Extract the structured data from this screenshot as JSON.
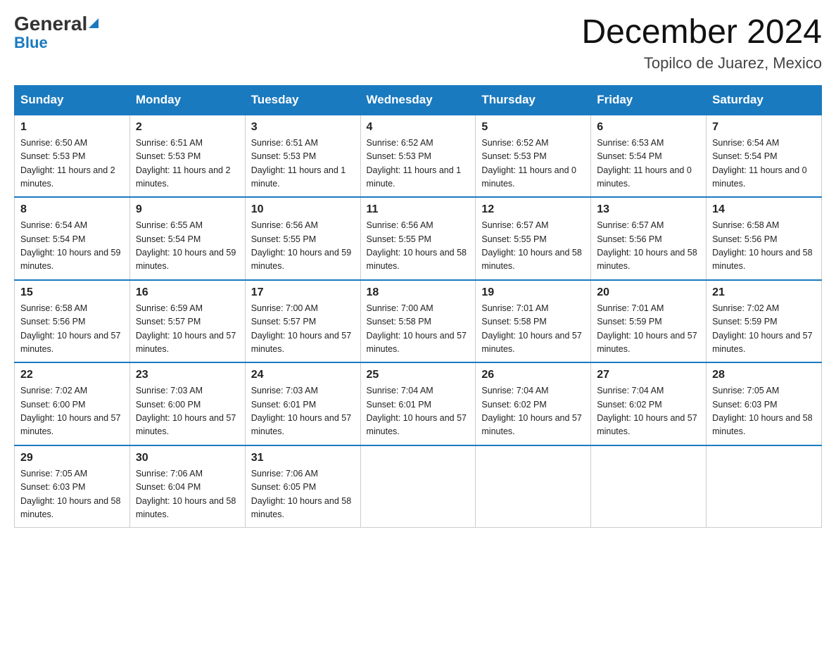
{
  "header": {
    "logo_general": "General",
    "logo_blue": "Blue",
    "month_title": "December 2024",
    "location": "Topilco de Juarez, Mexico"
  },
  "days_of_week": [
    "Sunday",
    "Monday",
    "Tuesday",
    "Wednesday",
    "Thursday",
    "Friday",
    "Saturday"
  ],
  "weeks": [
    [
      {
        "day": "1",
        "sunrise": "6:50 AM",
        "sunset": "5:53 PM",
        "daylight": "11 hours and 2 minutes."
      },
      {
        "day": "2",
        "sunrise": "6:51 AM",
        "sunset": "5:53 PM",
        "daylight": "11 hours and 2 minutes."
      },
      {
        "day": "3",
        "sunrise": "6:51 AM",
        "sunset": "5:53 PM",
        "daylight": "11 hours and 1 minute."
      },
      {
        "day": "4",
        "sunrise": "6:52 AM",
        "sunset": "5:53 PM",
        "daylight": "11 hours and 1 minute."
      },
      {
        "day": "5",
        "sunrise": "6:52 AM",
        "sunset": "5:53 PM",
        "daylight": "11 hours and 0 minutes."
      },
      {
        "day": "6",
        "sunrise": "6:53 AM",
        "sunset": "5:54 PM",
        "daylight": "11 hours and 0 minutes."
      },
      {
        "day": "7",
        "sunrise": "6:54 AM",
        "sunset": "5:54 PM",
        "daylight": "11 hours and 0 minutes."
      }
    ],
    [
      {
        "day": "8",
        "sunrise": "6:54 AM",
        "sunset": "5:54 PM",
        "daylight": "10 hours and 59 minutes."
      },
      {
        "day": "9",
        "sunrise": "6:55 AM",
        "sunset": "5:54 PM",
        "daylight": "10 hours and 59 minutes."
      },
      {
        "day": "10",
        "sunrise": "6:56 AM",
        "sunset": "5:55 PM",
        "daylight": "10 hours and 59 minutes."
      },
      {
        "day": "11",
        "sunrise": "6:56 AM",
        "sunset": "5:55 PM",
        "daylight": "10 hours and 58 minutes."
      },
      {
        "day": "12",
        "sunrise": "6:57 AM",
        "sunset": "5:55 PM",
        "daylight": "10 hours and 58 minutes."
      },
      {
        "day": "13",
        "sunrise": "6:57 AM",
        "sunset": "5:56 PM",
        "daylight": "10 hours and 58 minutes."
      },
      {
        "day": "14",
        "sunrise": "6:58 AM",
        "sunset": "5:56 PM",
        "daylight": "10 hours and 58 minutes."
      }
    ],
    [
      {
        "day": "15",
        "sunrise": "6:58 AM",
        "sunset": "5:56 PM",
        "daylight": "10 hours and 57 minutes."
      },
      {
        "day": "16",
        "sunrise": "6:59 AM",
        "sunset": "5:57 PM",
        "daylight": "10 hours and 57 minutes."
      },
      {
        "day": "17",
        "sunrise": "7:00 AM",
        "sunset": "5:57 PM",
        "daylight": "10 hours and 57 minutes."
      },
      {
        "day": "18",
        "sunrise": "7:00 AM",
        "sunset": "5:58 PM",
        "daylight": "10 hours and 57 minutes."
      },
      {
        "day": "19",
        "sunrise": "7:01 AM",
        "sunset": "5:58 PM",
        "daylight": "10 hours and 57 minutes."
      },
      {
        "day": "20",
        "sunrise": "7:01 AM",
        "sunset": "5:59 PM",
        "daylight": "10 hours and 57 minutes."
      },
      {
        "day": "21",
        "sunrise": "7:02 AM",
        "sunset": "5:59 PM",
        "daylight": "10 hours and 57 minutes."
      }
    ],
    [
      {
        "day": "22",
        "sunrise": "7:02 AM",
        "sunset": "6:00 PM",
        "daylight": "10 hours and 57 minutes."
      },
      {
        "day": "23",
        "sunrise": "7:03 AM",
        "sunset": "6:00 PM",
        "daylight": "10 hours and 57 minutes."
      },
      {
        "day": "24",
        "sunrise": "7:03 AM",
        "sunset": "6:01 PM",
        "daylight": "10 hours and 57 minutes."
      },
      {
        "day": "25",
        "sunrise": "7:04 AM",
        "sunset": "6:01 PM",
        "daylight": "10 hours and 57 minutes."
      },
      {
        "day": "26",
        "sunrise": "7:04 AM",
        "sunset": "6:02 PM",
        "daylight": "10 hours and 57 minutes."
      },
      {
        "day": "27",
        "sunrise": "7:04 AM",
        "sunset": "6:02 PM",
        "daylight": "10 hours and 57 minutes."
      },
      {
        "day": "28",
        "sunrise": "7:05 AM",
        "sunset": "6:03 PM",
        "daylight": "10 hours and 58 minutes."
      }
    ],
    [
      {
        "day": "29",
        "sunrise": "7:05 AM",
        "sunset": "6:03 PM",
        "daylight": "10 hours and 58 minutes."
      },
      {
        "day": "30",
        "sunrise": "7:06 AM",
        "sunset": "6:04 PM",
        "daylight": "10 hours and 58 minutes."
      },
      {
        "day": "31",
        "sunrise": "7:06 AM",
        "sunset": "6:05 PM",
        "daylight": "10 hours and 58 minutes."
      },
      null,
      null,
      null,
      null
    ]
  ],
  "labels": {
    "sunrise": "Sunrise:",
    "sunset": "Sunset:",
    "daylight": "Daylight:"
  }
}
